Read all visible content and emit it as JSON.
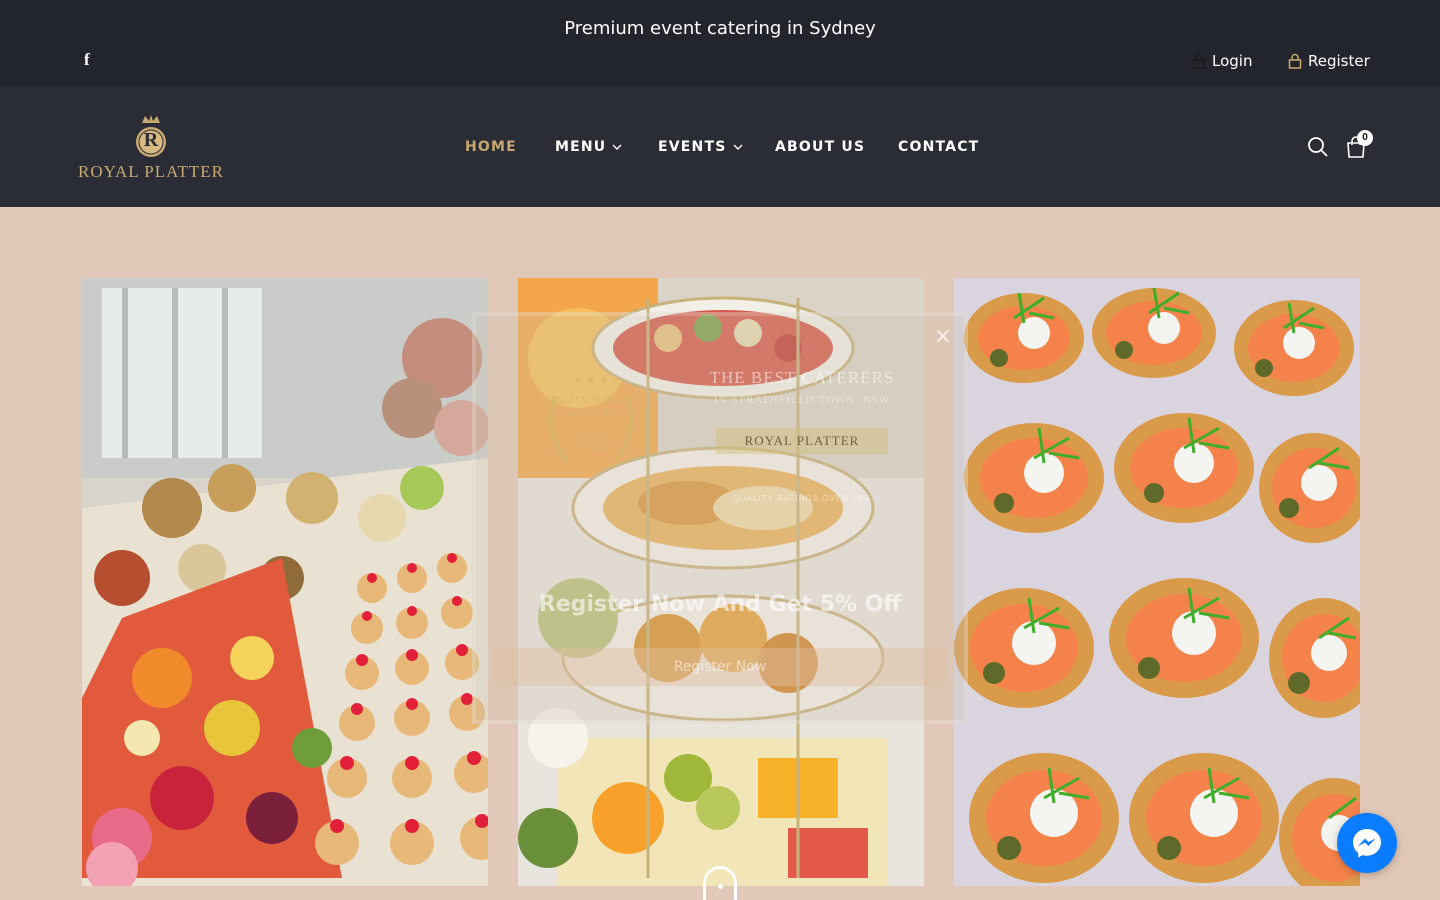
{
  "topbar": {
    "announcement": "Premium event catering in Sydney",
    "social_icon": "facebook-icon",
    "login_label": "Login",
    "register_label": "Register"
  },
  "header": {
    "logo_letter": "R",
    "logo_text": "ROYAL PLATTER",
    "nav": {
      "home": "HOME",
      "menu": "MENU",
      "events": "EVENTS",
      "about": "ABOUT US",
      "contact": "CONTACT"
    },
    "cart_count": "0"
  },
  "popup": {
    "close_glyph": "×",
    "award_text": "QUALITY BUSINESS AWARDS",
    "award_year": "2025",
    "best_title": "THE BEST CATERERS",
    "best_subtitle": "IN STRATHFIELD TOWN, NSW",
    "best_brand": "ROYAL PLATTER",
    "best_rating": "QUALITY RATINGS OVER 98%",
    "headline": "Register Now And Get 5% Off",
    "button_label": "Register Now"
  },
  "colors": {
    "topbar_bg": "#23252c",
    "navbar_bg": "#2a2d36",
    "accent_gold": "#c9a870",
    "page_bg": "#e2c8b8",
    "messenger_blue": "#0a7cff"
  }
}
